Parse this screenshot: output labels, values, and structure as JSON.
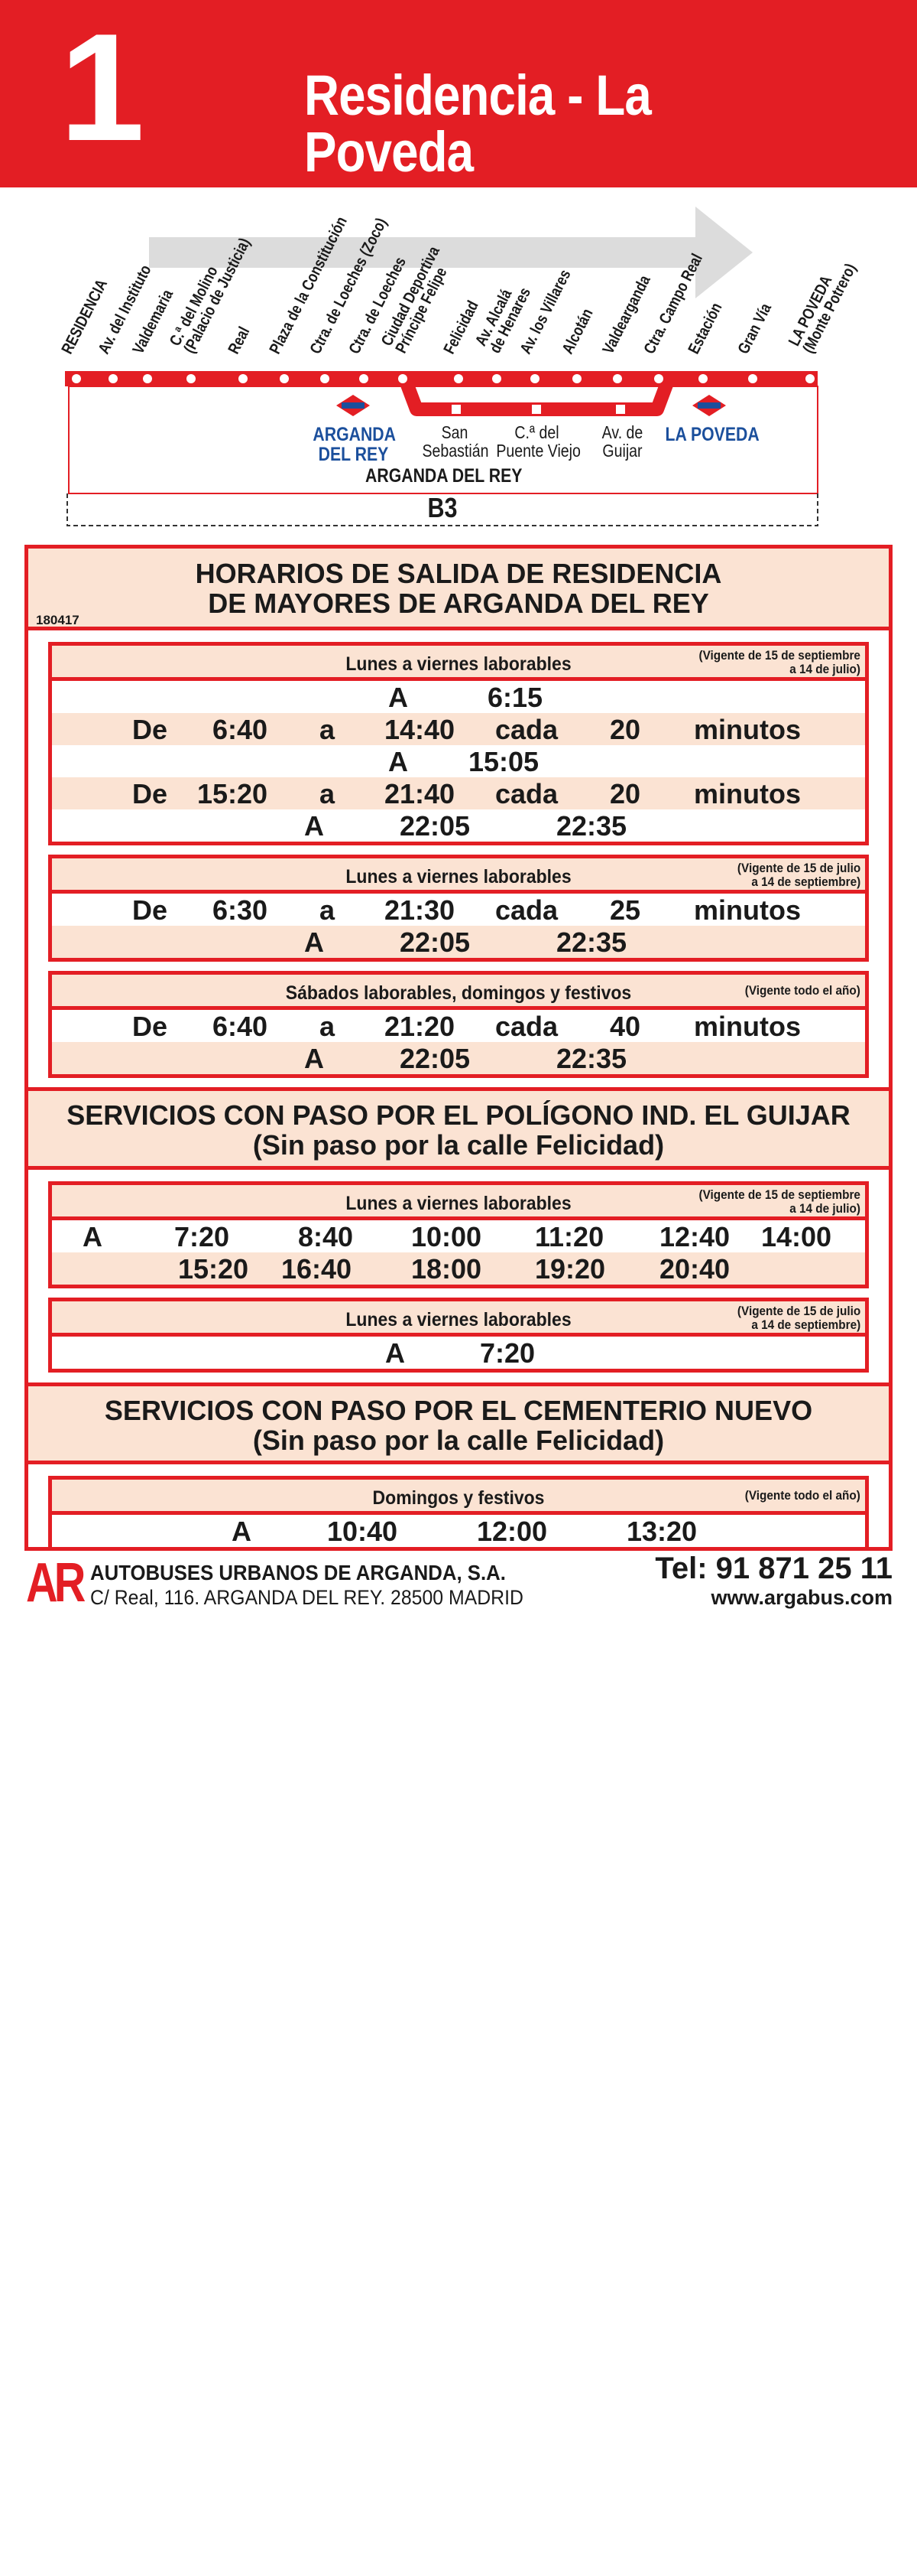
{
  "header": {
    "line_number": "1",
    "title": "Residencia - La Poveda"
  },
  "route": {
    "stops": [
      "RESIDENCIA",
      "Av. del Instituto",
      "Valdemaria",
      "C.ª del Molino\n(Palacio de Justicia)",
      "Real",
      "Plaza de la Constitución",
      "Ctra. de Loeches (Zoco)",
      "Ctra. de Loeches",
      "Ciudad Deportiva\nPríncipe Felipe",
      "Felicidad",
      "Av. Alcalá\nde Henares",
      "Av. los Villares",
      "Alcotán",
      "Valdearganda",
      "Ctra. Campo Real",
      "Estación",
      "Gran Vía",
      "LA POVEDA\n(Monte Potrero)"
    ],
    "metro_left": "ARGANDA\nDEL REY",
    "metro_right": "LA POVEDA",
    "metro_icon": "metro-icon",
    "branch_stops": [
      "San\nSebastián",
      "C.ª del\nPuente Viejo",
      "Av. de\nGuijar"
    ],
    "area": "ARGANDA DEL REY",
    "interchange": "B3",
    "colors": {
      "accent": "#e31e24",
      "metro": "#1b4f9c",
      "arrow": "#dcdcdc"
    }
  },
  "main": {
    "title": "HORARIOS DE SALIDA DE RESIDENCIA\nDE MAYORES DE ARGANDA DEL REY",
    "code": "180417",
    "box1": {
      "title": "Lunes a viernes laborables",
      "validity": "(Vigente de 15 de septiembre\na 14 de julio)",
      "rows": [
        [
          "A",
          "6:15"
        ],
        [
          "De",
          "6:40",
          "a",
          "14:40",
          "cada",
          "20",
          "minutos"
        ],
        [
          "A",
          "15:05"
        ],
        [
          "De",
          "15:20",
          "a",
          "21:40",
          "cada",
          "20",
          "minutos"
        ],
        [
          "A",
          "22:05",
          "22:35"
        ]
      ]
    },
    "box2": {
      "title": "Lunes a viernes laborables",
      "validity": "(Vigente de 15 de julio\na 14 de septiembre)",
      "rows": [
        [
          "De",
          "6:30",
          "a",
          "21:30",
          "cada",
          "25",
          "minutos"
        ],
        [
          "A",
          "22:05",
          "22:35"
        ]
      ]
    },
    "box3": {
      "title": "Sábados laborables, domingos y festivos",
      "validity": "(Vigente todo el año)",
      "rows": [
        [
          "De",
          "6:40",
          "a",
          "21:20",
          "cada",
          "40",
          "minutos"
        ],
        [
          "A",
          "22:05",
          "22:35"
        ]
      ]
    },
    "section2_title": "SERVICIOS CON PASO POR EL POLÍGONO IND. EL GUIJAR\n(Sin paso por la calle Felicidad)",
    "box4": {
      "title": "Lunes a viernes laborables",
      "validity": "(Vigente de 15 de septiembre\na 14 de julio)",
      "rows": [
        [
          "A",
          "7:20",
          "8:40",
          "10:00",
          "11:20",
          "12:40",
          "14:00"
        ],
        [
          "15:20",
          "16:40",
          "18:00",
          "19:20",
          "20:40"
        ]
      ]
    },
    "box5": {
      "title": "Lunes a viernes laborables",
      "validity": "(Vigente de 15 de julio\na 14 de septiembre)",
      "rows": [
        [
          "A",
          "7:20"
        ]
      ]
    },
    "section3_title": "SERVICIOS CON PASO POR EL CEMENTERIO NUEVO\n(Sin paso por la calle Felicidad)",
    "box6": {
      "title": "Domingos y festivos",
      "validity": "(Vigente todo el año)",
      "rows": [
        [
          "A",
          "10:40",
          "12:00",
          "13:20"
        ]
      ]
    }
  },
  "footer": {
    "logo": "AR",
    "company": "AUTOBUSES URBANOS DE ARGANDA, S.A.",
    "address": "C/ Real, 116. ARGANDA DEL REY. 28500 MADRID",
    "phone": "Tel: 91 871 25 11",
    "web": "www.argabus.com"
  }
}
